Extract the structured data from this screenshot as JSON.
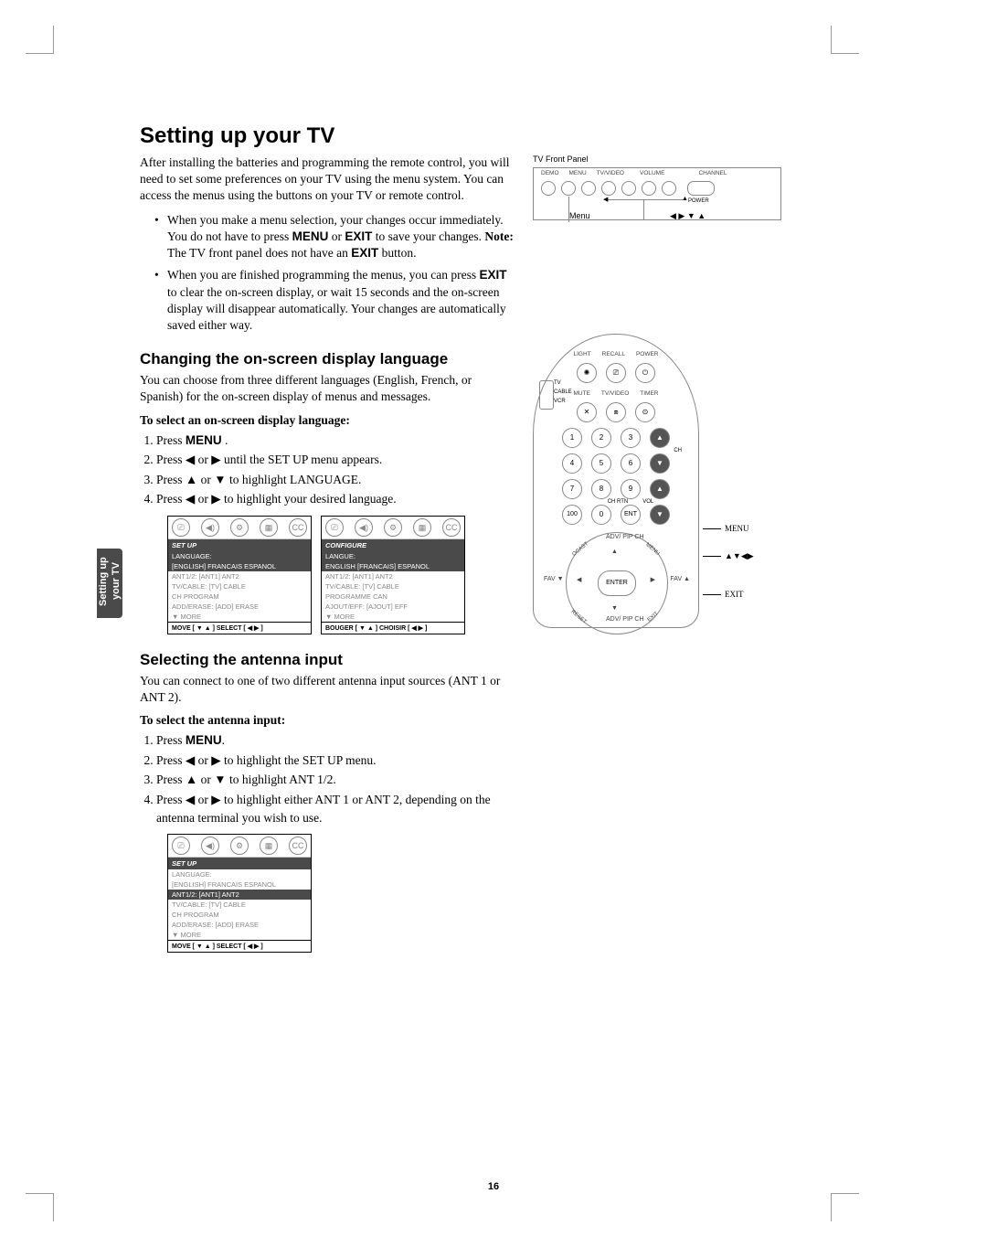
{
  "page_number": "16",
  "sidebar_tab": "Setting up your TV",
  "h1": "Setting up your TV",
  "intro": "After installing the batteries and programming the remote control, you will need to set some preferences on your TV using the menu system. You can access the menus using the buttons on your TV or remote control.",
  "bullet1_a": "When you make a menu selection, your changes occur immediately. You do not have to press ",
  "bullet1_menu": "MENU",
  "bullet1_b": " or ",
  "bullet1_exit": "EXIT",
  "bullet1_c": " to save your changes. ",
  "bullet1_note_label": "Note:",
  "bullet1_note": " The TV front panel does not have an ",
  "bullet1_note_exit": "EXIT",
  "bullet1_note_end": " button.",
  "bullet2_a": "When you are finished programming the menus, you can press ",
  "bullet2_exit": "EXIT",
  "bullet2_b": " to clear the on-screen display, or wait 15 seconds and the on-screen display will disappear automatically. Your changes are automatically saved either way.",
  "h2_lang": "Changing the on-screen display language",
  "lang_intro": "You can choose from three different languages (English, French, or Spanish) for the on-screen display of menus and messages.",
  "lang_subhead": "To select an on-screen display language:",
  "lang_steps": {
    "s1a": "Press ",
    "s1b": "MENU",
    "s1c": " .",
    "s2": "Press ◀ or ▶ until the SET UP menu appears.",
    "s3": "Press ▲ or ▼ to highlight LANGUAGE.",
    "s4": "Press ◀ or ▶ to highlight your desired language."
  },
  "h2_ant": "Selecting the antenna input",
  "ant_intro": "You can connect to one of two different antenna input sources (ANT 1 or ANT 2).",
  "ant_subhead": "To select the antenna input:",
  "ant_steps": {
    "s1a": "Press ",
    "s1b": "MENU",
    "s1c": ".",
    "s2": "Press ◀ or ▶ to highlight the SET UP menu.",
    "s3": "Press ▲ or ▼ to highlight ANT 1/2.",
    "s4": "Press ◀ or ▶ to highlight either ANT 1 or ANT 2, depending on the antenna terminal you wish to use."
  },
  "osd_en": {
    "title": "SET UP",
    "rows": [
      "LANGUAGE:",
      "          [ENGLISH] FRANCAIS ESPANOL",
      "ANT1/2:        [ANT1] ANT2",
      "TV/CABLE:      [TV] CABLE",
      "CH PROGRAM",
      "ADD/ERASE:     [ADD] ERASE",
      "▼ MORE"
    ],
    "footer": "MOVE [ ▼ ▲ ]    SELECT [ ◀  ▶ ]"
  },
  "osd_fr": {
    "title": "CONFIGURE",
    "rows": [
      "LANGUE:",
      "     ENGLISH [FRANCAIS] ESPANOL",
      "ANT1/2:        [ANT1] ANT2",
      "TV/CABLE:      [TV] CABLE",
      "PROGRAMME CAN",
      "AJOUT/EFF:     [AJOUT] EFF",
      "▼ MORE"
    ],
    "footer": "BOUGER [ ▼ ▲ ]   CHOISIR [ ◀  ▶ ]"
  },
  "osd_ant": {
    "title": "SET UP",
    "rows_top": [
      "LANGUAGE:",
      "          [ENGLISH] FRANCAIS ESPANOL"
    ],
    "row_hl": "ANT1/2:        [ANT1] ANT2",
    "rows_bot": [
      "TV/CABLE:      [TV] CABLE",
      "CH PROGRAM",
      "ADD/ERASE:     [ADD] ERASE",
      "▼ MORE"
    ],
    "footer": "MOVE [ ▼ ▲ ]    SELECT [ ◀  ▶ ]"
  },
  "front_panel": {
    "title": "TV Front Panel",
    "top_labels": [
      "DEMO",
      "MENU",
      "TV/VIDEO",
      "VOLUME",
      "",
      "CHANNEL",
      ""
    ],
    "menu_label": "Menu",
    "arrows_label": "◀ ▶ ▼ ▲",
    "power_label": "POWER"
  },
  "remote": {
    "row1_labels": [
      "LIGHT",
      "RECALL",
      "POWER"
    ],
    "row2_labels": [
      "MUTE",
      "TV/VIDEO",
      "TIMER"
    ],
    "switch_labels": [
      "TV",
      "CABLE",
      "VCR"
    ],
    "keypad": {
      "r1": [
        "1",
        "2",
        "3"
      ],
      "r2": [
        "4",
        "5",
        "6"
      ],
      "r3": [
        "7",
        "8",
        "9"
      ],
      "r4": [
        "100",
        "0",
        "ENT"
      ]
    },
    "side_labels": {
      "ch": "CH",
      "vol": "VOL",
      "chrtn": "CH RTN"
    },
    "dpad": {
      "top": "ADV/\nPIP CH",
      "bottom": "ADV/\nPIP CH",
      "center": "ENTER",
      "tl": "OCAST",
      "tr": "MENU",
      "bl": "RESET",
      "br": "EXIT",
      "left": "FAV ▼",
      "right": "FAV ▲"
    },
    "callout_menu": "MENU",
    "callout_arrows": "▲▼◀▶",
    "callout_exit": "EXIT"
  }
}
